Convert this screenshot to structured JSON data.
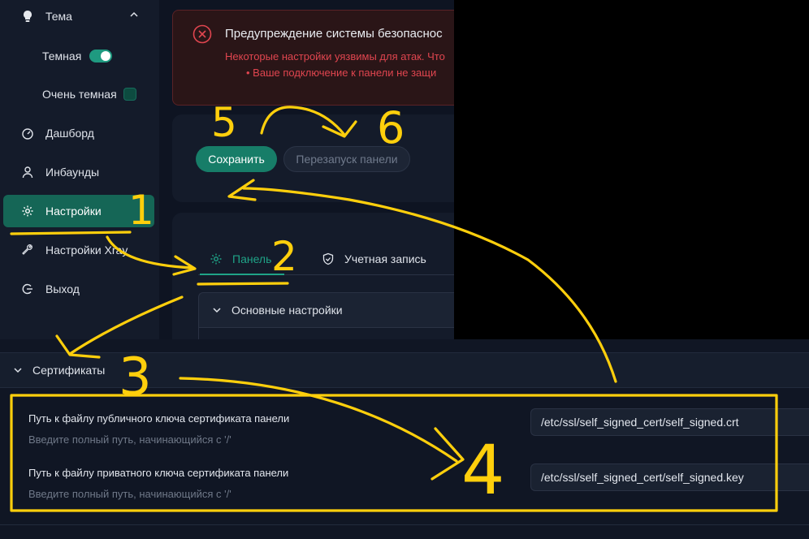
{
  "sidebar": {
    "theme": {
      "label": "Тема",
      "icon": "bulb-icon"
    },
    "dark_toggle": {
      "label": "Темная",
      "on": true
    },
    "ultra_dark": {
      "label": "Очень темная",
      "checked": false
    },
    "items": [
      {
        "label": "Дашборд",
        "icon": "dashboard-icon",
        "active": false
      },
      {
        "label": "Инбаунды",
        "icon": "user-icon",
        "active": false
      },
      {
        "label": "Настройки",
        "icon": "gear-icon",
        "active": true
      },
      {
        "label": "Настройки Xray",
        "icon": "wrench-icon",
        "active": false
      },
      {
        "label": "Выход",
        "icon": "logout-icon",
        "active": false
      }
    ]
  },
  "alert": {
    "title": "Предупреждение системы безопаснос",
    "description": "Некоторые настройки уязвимы для атак. Что",
    "bullet": "• Ваше подключение к панели не защи"
  },
  "actions": {
    "save_label": "Сохранить",
    "restart_label": "Перезапуск панели"
  },
  "tabs": [
    {
      "label": "Панель",
      "active": true
    },
    {
      "label": "Учетная запись",
      "active": false
    }
  ],
  "sections": {
    "basic": "Основные настройки",
    "certificates": "Сертификаты"
  },
  "cert": {
    "public": {
      "title": "Путь к файлу публичного ключа сертификата панели",
      "hint": "Введите полный путь, начинающийся с '/'",
      "value": "/etc/ssl/self_signed_cert/self_signed.crt"
    },
    "private": {
      "title": "Путь к файлу приватного ключа сертификата панели",
      "hint": "Введите полный путь, начинающийся с '/'",
      "value": "/etc/ssl/self_signed_cert/self_signed.key"
    }
  },
  "annotations": {
    "n1": "1",
    "n2": "2",
    "n3": "3",
    "n4": "4",
    "n5": "5",
    "n6": "6"
  },
  "colors": {
    "accent": "#177d68",
    "annotation": "#ffcf0c",
    "danger": "#e0454f",
    "sidebar": "#141b2a"
  }
}
